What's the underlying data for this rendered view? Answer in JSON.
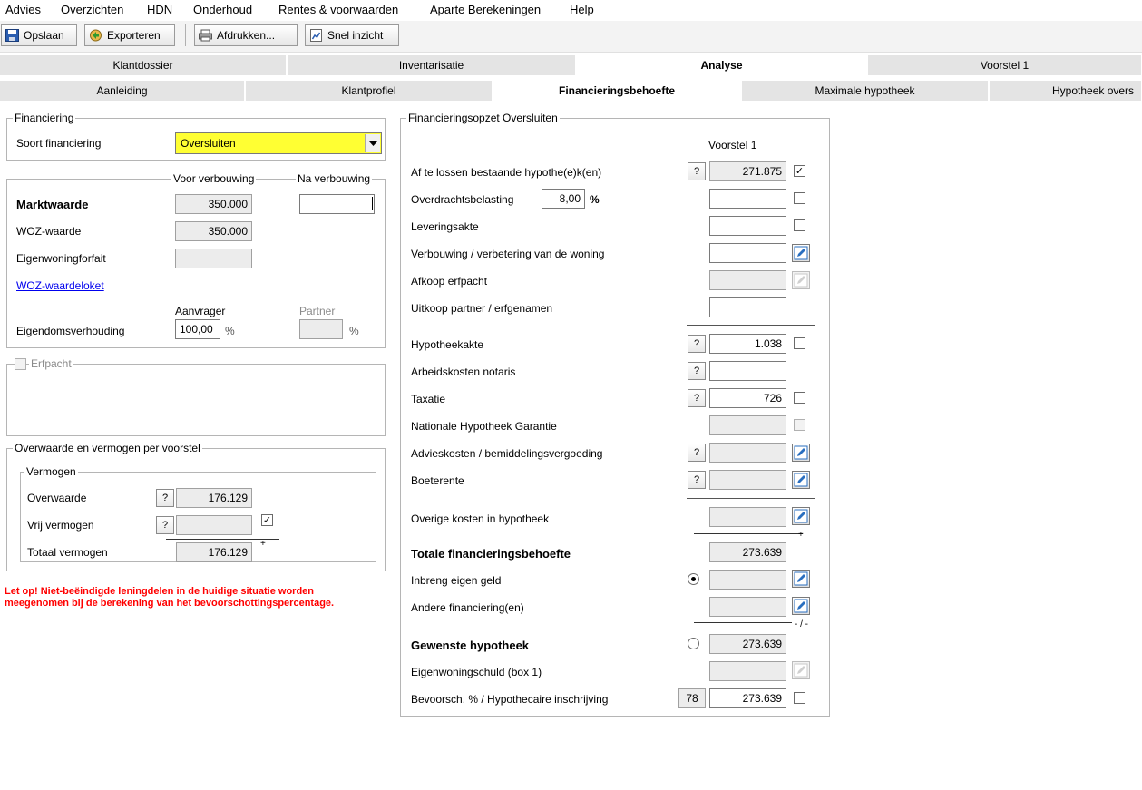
{
  "menu": [
    "Advies",
    "Overzichten",
    "HDN",
    "Onderhoud",
    "Rentes & voorwaarden",
    "Aparte Berekeningen",
    "Help"
  ],
  "toolbar": {
    "save": "Opslaan",
    "export": "Exporteren",
    "print": "Afdrukken...",
    "quick": "Snel inzicht"
  },
  "tabs_main": [
    "Klantdossier",
    "Inventarisatie",
    "Analyse",
    "Voorstel 1"
  ],
  "tabs_main_active": "Analyse",
  "tabs_sub": [
    "Aanleiding",
    "Klantprofiel",
    "Financieringsbehoefte",
    "Maximale hypotheek",
    "Hypotheek overs"
  ],
  "tabs_sub_active": "Financieringsbehoefte",
  "financiering": {
    "legend": "Financiering",
    "soort_label": "Soort financiering",
    "soort_value": "Oversluiten",
    "highlight": "#ffff33"
  },
  "waarde": {
    "col_voor": "Voor verbouwing",
    "col_na": "Na verbouwing",
    "marktwaarde_label": "Marktwaarde",
    "marktwaarde_voor": "350.000",
    "marktwaarde_na": "",
    "woz_label": "WOZ-waarde",
    "woz_value": "350.000",
    "forfait_label": "Eigenwoningforfait",
    "forfait_value": "",
    "loket_link": "WOZ-waardeloket",
    "aanvrager": "Aanvrager",
    "partner": "Partner",
    "eigendom_label": "Eigendomsverhouding",
    "eigendom_value": "100,00",
    "pct": "%"
  },
  "erfpacht": {
    "legend": "Erfpacht"
  },
  "overwaarde": {
    "legend": "Overwaarde en vermogen per voorstel",
    "vermogen_legend": "Vermogen",
    "overwaarde_label": "Overwaarde",
    "overwaarde_value": "176.129",
    "vrij_label": "Vrij vermogen",
    "vrij_value": "",
    "totaal_label": "Totaal vermogen",
    "totaal_value": "176.129",
    "plus": "+"
  },
  "warning": {
    "line1": "Let op! Niet-beëindigde leningdelen in de huidige situatie worden",
    "line2": "meegenomen bij de berekening van het bevoorschottingspercentage.",
    "color": "#ff0000"
  },
  "opzet": {
    "legend": "Financieringsopzet Oversluiten",
    "col_header": "Voorstel 1",
    "q": "?",
    "pct": "%",
    "plus": "+",
    "minus": "- / -",
    "rows": {
      "aflossen": {
        "label": "Af te lossen bestaande hypothe(e)k(en)",
        "value": "271.875"
      },
      "overdracht": {
        "label": "Overdrachtsbelasting",
        "pct_value": "8,00",
        "value": ""
      },
      "levering": {
        "label": "Leveringsakte",
        "value": ""
      },
      "verbouwing": {
        "label": "Verbouwing / verbetering van de woning",
        "value": ""
      },
      "afkoop": {
        "label": "Afkoop erfpacht",
        "value": ""
      },
      "uitkoop": {
        "label": "Uitkoop partner / erfgenamen",
        "value": ""
      },
      "hypotheekakte": {
        "label": "Hypotheekakte",
        "value": "1.038"
      },
      "arbeid": {
        "label": "Arbeidskosten notaris",
        "value": ""
      },
      "taxatie": {
        "label": "Taxatie",
        "value": "726"
      },
      "nhg": {
        "label": "Nationale Hypotheek Garantie",
        "value": ""
      },
      "advies": {
        "label": "Advieskosten / bemiddelingsvergoeding",
        "value": ""
      },
      "boete": {
        "label": "Boeterente",
        "value": ""
      },
      "overige": {
        "label": "Overige kosten in hypotheek",
        "value": ""
      },
      "totaal": {
        "label": "Totale financieringsbehoefte",
        "value": "273.639"
      },
      "inbreng": {
        "label": "Inbreng eigen geld",
        "value": ""
      },
      "andere": {
        "label": "Andere financiering(en)",
        "value": ""
      },
      "gewenst": {
        "label": "Gewenste hypotheek",
        "value": "273.639"
      },
      "eigenwoning": {
        "label": "Eigenwoningschuld (box 1)",
        "value": ""
      },
      "bevoorsch": {
        "label": "Bevoorsch. % / Hypothecaire inschrijving",
        "pct_value": "78",
        "value": "273.639"
      }
    }
  }
}
